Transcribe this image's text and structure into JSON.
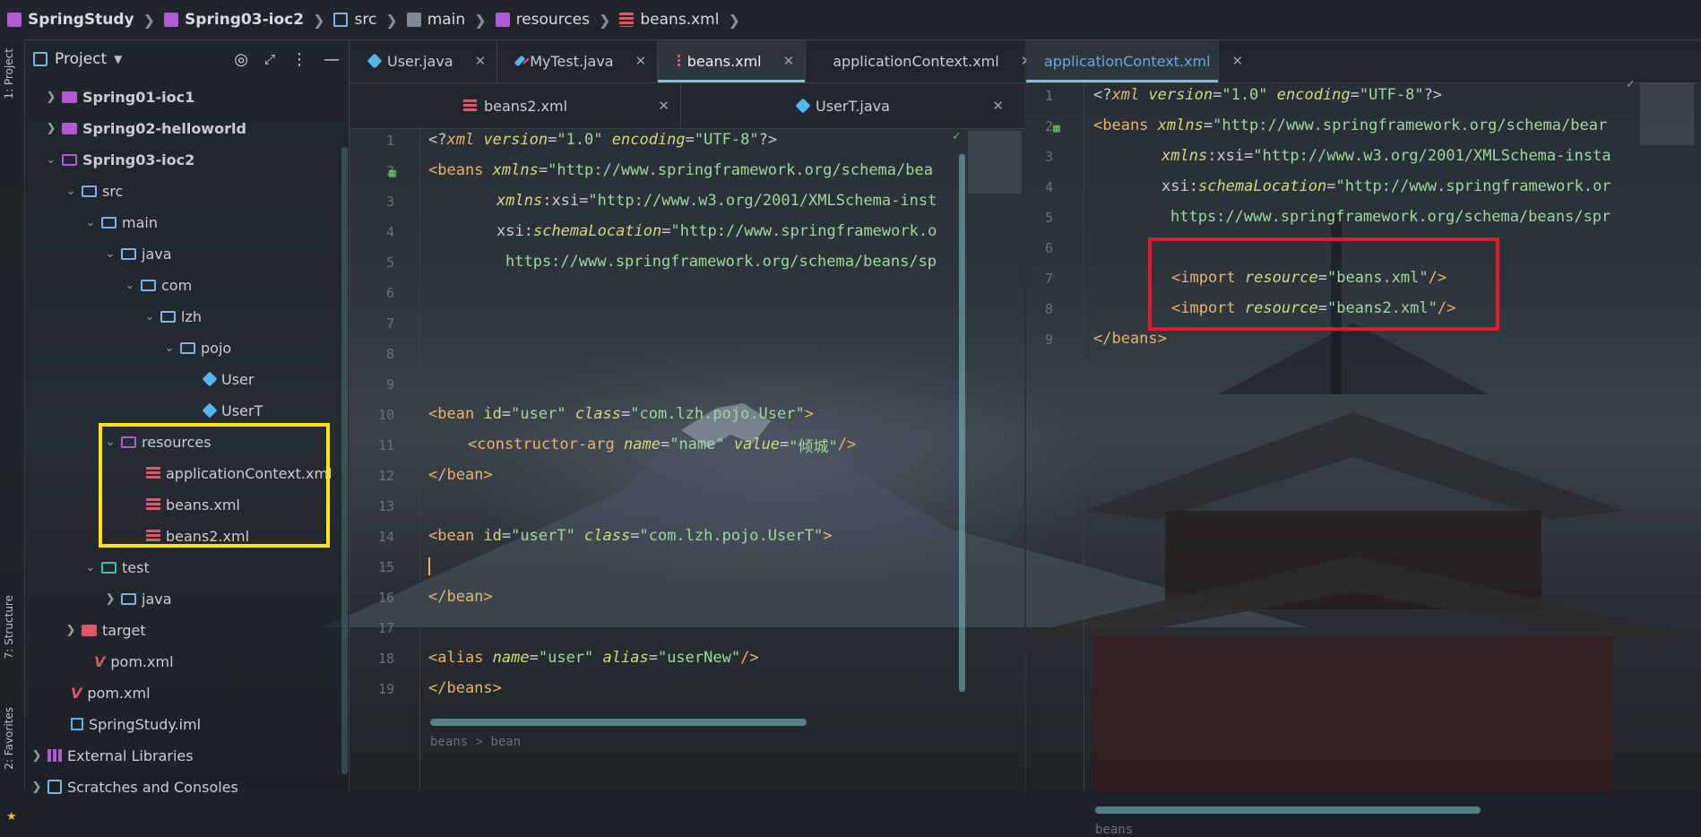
{
  "breadcrumb": {
    "items": [
      "SpringStudy",
      "Spring03-ioc2",
      "src",
      "main",
      "resources",
      "beans.xml"
    ]
  },
  "sidebar_strip": {
    "project_label": "1: Project",
    "structure_label": "7: Structure",
    "favorites_label": "2: Favorites"
  },
  "project_panel": {
    "title": "Project",
    "tree": [
      {
        "label": "Spring01-ioc1",
        "kind": "module-collapsed"
      },
      {
        "label": "Spring02-helloworld",
        "kind": "module-collapsed"
      },
      {
        "label": "Spring03-ioc2",
        "kind": "module-expanded"
      },
      {
        "label": "src",
        "kind": "folder"
      },
      {
        "label": "main",
        "kind": "folder"
      },
      {
        "label": "java",
        "kind": "folder"
      },
      {
        "label": "com",
        "kind": "folder"
      },
      {
        "label": "lzh",
        "kind": "folder"
      },
      {
        "label": "pojo",
        "kind": "folder"
      },
      {
        "label": "User",
        "kind": "class"
      },
      {
        "label": "UserT",
        "kind": "class"
      },
      {
        "label": "resources",
        "kind": "resources"
      },
      {
        "label": "applicationContext.xml",
        "kind": "xml"
      },
      {
        "label": "beans.xml",
        "kind": "xml"
      },
      {
        "label": "beans2.xml",
        "kind": "xml"
      },
      {
        "label": "test",
        "kind": "test-folder"
      },
      {
        "label": "java",
        "kind": "folder"
      },
      {
        "label": "target",
        "kind": "target"
      },
      {
        "label": "pom.xml",
        "kind": "maven"
      },
      {
        "label": "pom.xml",
        "kind": "maven"
      },
      {
        "label": "SpringStudy.iml",
        "kind": "iml"
      },
      {
        "label": "External Libraries",
        "kind": "libs"
      },
      {
        "label": "Scratches and Consoles",
        "kind": "scratch"
      }
    ]
  },
  "editor_left": {
    "tabs_row1": [
      "User.java",
      "MyTest.java",
      "beans.xml",
      "applicationContext.xml"
    ],
    "active_tab": "beans.xml",
    "tabs_row2": [
      "beans2.xml",
      "UserT.java"
    ],
    "line_numbers": [
      "1",
      "2",
      "3",
      "4",
      "5",
      "6",
      "7",
      "8",
      "9",
      "10",
      "11",
      "12",
      "13",
      "14",
      "15",
      "16",
      "17",
      "18",
      "19"
    ],
    "code": {
      "l1": [
        "<?",
        "xml ",
        "version",
        "=",
        "\"1.0\" ",
        "encoding",
        "=",
        "\"UTF-8\"",
        "?>"
      ],
      "l2": [
        "<beans ",
        "xmlns",
        "=",
        "\"http://www.springframework.org/schema/bea"
      ],
      "l3": [
        "xmlns",
        ":",
        "xsi",
        "=",
        "\"http://www.w3.org/2001/XMLSchema-inst"
      ],
      "l4": [
        "xsi",
        ":",
        "schemaLocation",
        "=",
        "\"http://www.springframework.o"
      ],
      "l5": [
        "https://www.springframework.org/schema/beans/sp"
      ],
      "l10": [
        "<bean ",
        "id",
        "=",
        "\"user\" ",
        "class",
        "=",
        "\"com.lzh.pojo.User\"",
        ">"
      ],
      "l11": [
        "<constructor-arg ",
        "name",
        "=",
        "\"name\" ",
        "value",
        "=",
        "\"倾城\"",
        "/>"
      ],
      "l12": [
        "</bean>"
      ],
      "l14": [
        "<bean ",
        "id",
        "=",
        "\"userT\" ",
        "class",
        "=",
        "\"com.lzh.pojo.UserT\"",
        ">"
      ],
      "l16": [
        "</bean>"
      ],
      "l18": [
        "<alias ",
        "name",
        "=",
        "\"user\" ",
        "alias",
        "=",
        "\"userNew\"",
        "/>"
      ],
      "l19": [
        "</beans>"
      ]
    },
    "footer": "beans  >  bean"
  },
  "editor_right": {
    "tab": "applicationContext.xml",
    "line_numbers": [
      "1",
      "2",
      "3",
      "4",
      "5",
      "6",
      "7",
      "8",
      "9"
    ],
    "code": {
      "l1": [
        "<?",
        "xml ",
        "version",
        "=",
        "\"1.0\" ",
        "encoding",
        "=",
        "\"UTF-8\"",
        "?>"
      ],
      "l2": [
        "<beans ",
        "xmlns",
        "=",
        "\"http://www.springframework.org/schema/bear"
      ],
      "l3": [
        "xmlns",
        ":",
        "xsi",
        "=",
        "\"http://www.w3.org/2001/XMLSchema-insta"
      ],
      "l4": [
        "xsi",
        ":",
        "schemaLocation",
        "=",
        "\"http://www.springframework.or"
      ],
      "l5": [
        "https://www.springframework.org/schema/beans/spr"
      ],
      "l7": [
        "<import ",
        "resource",
        "=",
        "\"beans.xml\"",
        "/>"
      ],
      "l8": [
        "<import ",
        "resource",
        "=",
        "\"beans2.xml\"",
        "/>"
      ],
      "l9": [
        "</beans>"
      ]
    },
    "footer": "beans"
  },
  "colors": {
    "highlight_yellow": "#ffe600",
    "highlight_red": "#e8172b",
    "accent": "#7ec3d6"
  }
}
